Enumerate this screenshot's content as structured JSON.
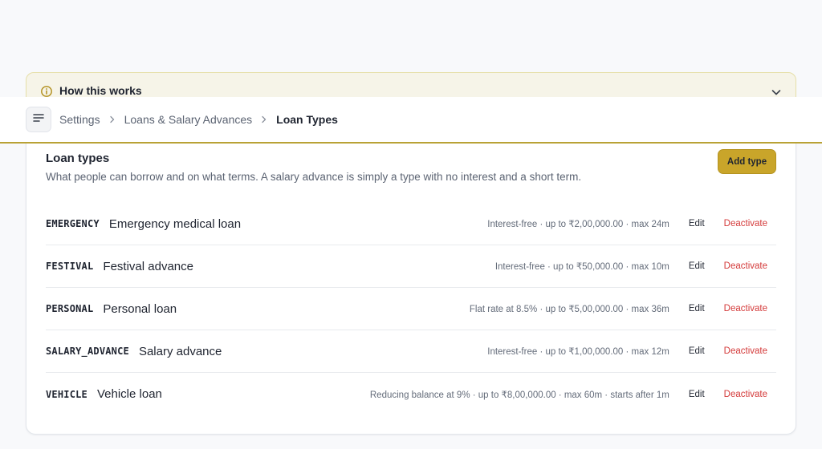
{
  "banner": {
    "title": "How this works"
  },
  "breadcrumb": [
    "Settings",
    "Loans & Salary Advances",
    "Loan Types"
  ],
  "card": {
    "title": "Loan types",
    "description": "What people can borrow and on what terms. A salary advance is simply a type with no interest and a short term.",
    "add_label": "Add type"
  },
  "actions": {
    "edit": "Edit",
    "deactivate": "Deactivate"
  },
  "loan_types": [
    {
      "code": "EMERGENCY",
      "name": "Emergency medical loan",
      "terms": "Interest-free · up to ₹2,00,000.00 · max 24m"
    },
    {
      "code": "FESTIVAL",
      "name": "Festival advance",
      "terms": "Interest-free · up to ₹50,000.00 · max 10m"
    },
    {
      "code": "PERSONAL",
      "name": "Personal loan",
      "terms": "Flat rate at 8.5% · up to ₹5,00,000.00 · max 36m"
    },
    {
      "code": "SALARY_ADVANCE",
      "name": "Salary advance",
      "terms": "Interest-free · up to ₹1,00,000.00 · max 12m"
    },
    {
      "code": "VEHICLE",
      "name": "Vehicle loan",
      "terms": "Reducing balance at 9% · up to ₹8,00,000.00 · max 60m · starts after 1m"
    }
  ],
  "colors": {
    "accent": "#c9a52a",
    "danger": "#d43a3a",
    "banner_bg": "#f6f4e8"
  },
  "icons": {
    "banner": "info-icon",
    "banner_toggle": "chevron-down-icon",
    "menu": "menu-icon",
    "separator": "chevron-right-icon"
  }
}
